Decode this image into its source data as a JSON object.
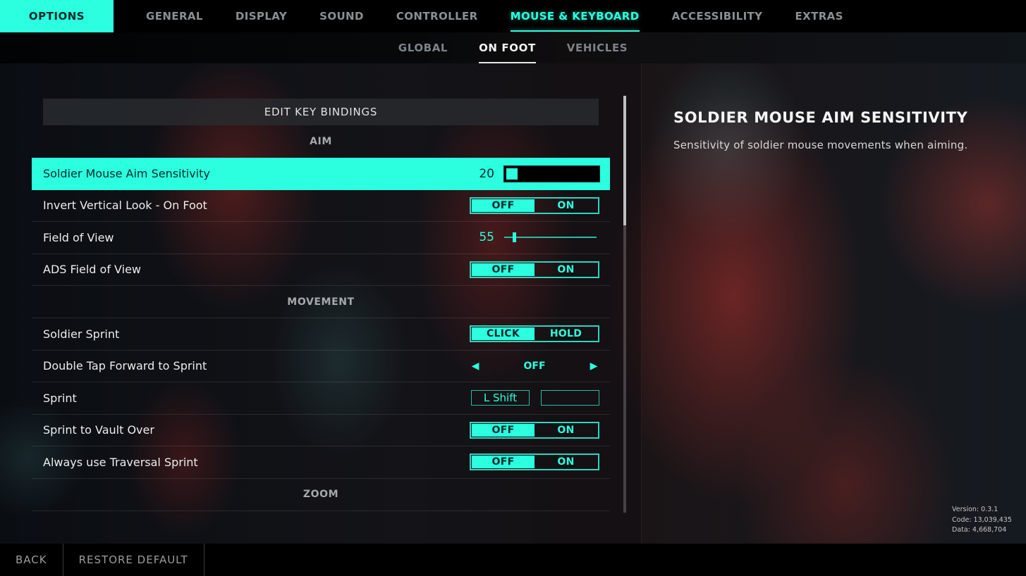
{
  "accent_color": "#2bffe0",
  "topnav": {
    "options_label": "OPTIONS",
    "tabs": [
      {
        "label": "GENERAL",
        "active": false
      },
      {
        "label": "DISPLAY",
        "active": false
      },
      {
        "label": "SOUND",
        "active": false
      },
      {
        "label": "CONTROLLER",
        "active": false
      },
      {
        "label": "MOUSE & KEYBOARD",
        "active": true
      },
      {
        "label": "ACCESSIBILITY",
        "active": false
      },
      {
        "label": "EXTRAS",
        "active": false
      }
    ]
  },
  "subnav": {
    "tabs": [
      {
        "label": "GLOBAL",
        "active": false
      },
      {
        "label": "ON FOOT",
        "active": true
      },
      {
        "label": "VEHICLES",
        "active": false
      }
    ]
  },
  "settings": {
    "edit_key_bindings_label": "EDIT KEY BINDINGS",
    "sections": {
      "aim": "AIM",
      "movement": "MOVEMENT",
      "zoom": "ZOOM"
    },
    "rows": {
      "soldier_mouse_aim_sensitivity": {
        "label": "Soldier Mouse Aim Sensitivity",
        "value": "20",
        "fill_fraction": 0.12,
        "selected": true
      },
      "invert_vertical_look": {
        "label": "Invert Vertical Look - On Foot",
        "options": [
          "OFF",
          "ON"
        ],
        "selected_option": "OFF"
      },
      "field_of_view": {
        "label": "Field of View",
        "value": "55",
        "thumb_fraction": 0.11
      },
      "ads_field_of_view": {
        "label": "ADS Field of View",
        "options": [
          "OFF",
          "ON"
        ],
        "selected_option": "OFF"
      },
      "soldier_sprint": {
        "label": "Soldier Sprint",
        "options": [
          "CLICK",
          "HOLD"
        ],
        "selected_option": "CLICK"
      },
      "double_tap_forward": {
        "label": "Double Tap Forward to Sprint",
        "value": "OFF"
      },
      "sprint": {
        "label": "Sprint",
        "primary_key": "L Shift",
        "secondary_key": ""
      },
      "sprint_to_vault": {
        "label": "Sprint to Vault Over",
        "options": [
          "OFF",
          "ON"
        ],
        "selected_option": "OFF"
      },
      "always_traversal_sprint": {
        "label": "Always use Traversal Sprint",
        "options": [
          "OFF",
          "ON"
        ],
        "selected_option": "OFF"
      }
    },
    "scroll_fraction_visible": 0.31
  },
  "description": {
    "title": "SOLDIER MOUSE AIM SENSITIVITY",
    "text": "Sensitivity of soldier mouse movements when aiming."
  },
  "version_info": {
    "version": "Version: 0.3.1",
    "code": "Code: 13,039,435",
    "data": "Data: 4,668,704"
  },
  "bottombar": {
    "back_label": "BACK",
    "restore_label": "RESTORE DEFAULT"
  }
}
